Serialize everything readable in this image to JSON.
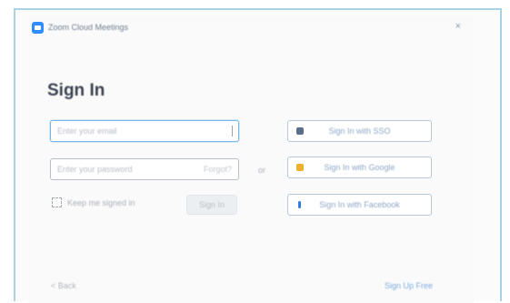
{
  "window": {
    "title": "Zoom Cloud Meetings",
    "close_symbol": "×",
    "app_icon": "zoom-camera-icon"
  },
  "signin": {
    "heading": "Sign In",
    "email_placeholder": "Enter your email",
    "password_placeholder": "Enter your password",
    "forgot_label": "Forgot?",
    "keep_label": "Keep me signed in",
    "signin_button": "Sign In",
    "or_label": "or"
  },
  "sso": [
    {
      "label": "Sign In with SSO",
      "icon": "key-icon",
      "color": "#5a6f8c"
    },
    {
      "label": "Sign In with Google",
      "icon": "google-icon",
      "color": "#f0b02a"
    },
    {
      "label": "Sign In with Facebook",
      "icon": "facebook-icon",
      "color": "#2f7de1"
    }
  ],
  "footer": {
    "back_label": "< Back",
    "signup_label": "Sign Up Free"
  },
  "colors": {
    "frame_border": "#a9d3e2",
    "focus_ring": "#7cb6ea",
    "link": "#7faee0"
  }
}
